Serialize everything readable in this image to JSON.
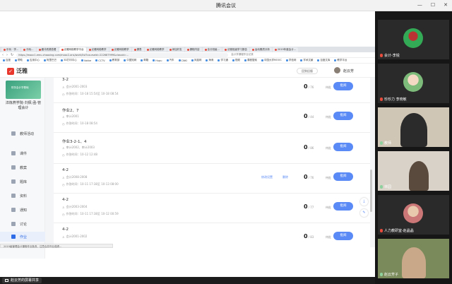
{
  "meeting": {
    "title": "腾讯会议"
  },
  "browser": {
    "tabs": [
      {
        "label": "乐玩 · 学..."
      },
      {
        "label": "乐玩..."
      },
      {
        "label": "缓冲资源查看"
      },
      {
        "label": "泛雅网络教学平台"
      },
      {
        "label": "泛雅网络教学"
      },
      {
        "label": "泛雅网络教学"
      },
      {
        "label": "课表"
      },
      {
        "label": "泛雅网络教学"
      },
      {
        "label": "添加好友"
      },
      {
        "label": "课程内容"
      },
      {
        "label": "全分班级..."
      },
      {
        "label": "泛雅班级学习报告"
      },
      {
        "label": "运动素质分析"
      },
      {
        "label": "2019年度会计..."
      }
    ],
    "url": "https://mooc1.emu.chaoxing.com/mooc2-ans/work/list?courseid=222687999&classid=...",
    "url_right": "会计学课程作业记录",
    "bookmarks": [
      "百度",
      "帮助",
      "应用中心",
      "阿里巴巴",
      "3D打印中心",
      "Vakke",
      "CCTV",
      "教育部",
      "中国知网",
      "邮箱",
      "Hupu",
      "汽车",
      "CNKI",
      "凤凰网",
      "海淘",
      "学习通",
      "视频",
      "课程搜索",
      "中国大学MOOC",
      "学信网",
      "学术文献",
      "百度文库",
      "教学平台"
    ]
  },
  "app": {
    "logo": "泛雅",
    "head_button": "回到旧版",
    "user": "赵云芳"
  },
  "sidebar": {
    "course_image_text": "财务会计学基础",
    "course_name": "淬炼燕学院-刘佩 函-管理会计",
    "items": [
      {
        "label": "教师活动"
      },
      {
        "label": "课件"
      },
      {
        "label": "教案"
      },
      {
        "label": "题库"
      },
      {
        "label": "资料"
      },
      {
        "label": "通知"
      },
      {
        "label": "讨论"
      },
      {
        "label": "作业"
      }
    ]
  },
  "homework": [
    {
      "title": "3-2",
      "cls": "会计2001-2003",
      "time": "作答时间：10-18 15:54至 10-18 08:54",
      "count": "0",
      "total": "/ 76",
      "count_label": "待批",
      "button": "批阅"
    },
    {
      "title": "作业2、7",
      "cls": "审计2001",
      "time": "作答时间：10-18 08:54",
      "count": "0",
      "total": "/ 44",
      "count_label": "待批",
      "button": "批阅"
    },
    {
      "title": "作业3-2-1、4",
      "cls": "审计2002、审计2003",
      "time": "作答时间：10-12 12:48",
      "count": "0",
      "total": "/ 86",
      "count_label": "待批",
      "button": "批阅"
    },
    {
      "title": "4-2",
      "cls": "会计2008-2008",
      "time": "作答时间：10-11 17:38至 10-13 08:00",
      "count": "0",
      "total": "/ 76",
      "count_label": "待批",
      "button": "批阅",
      "links": [
        "修改设置",
        "删除"
      ]
    },
    {
      "title": "4-2",
      "cls": "会计2003-2004",
      "time": "作答时间：10-11 17:38至 10-12 00:59",
      "count": "0",
      "total": "/ 77",
      "count_label": "待批",
      "button": "批阅"
    },
    {
      "title": "4-2",
      "cls": "会计2001-2002",
      "time": "",
      "count": "0",
      "total": "/ 83",
      "count_label": "待批",
      "button": "批阅"
    }
  ],
  "statusbar": "2019级管理会计课程作业批改，注意合并作业成绩...",
  "participants": [
    {
      "name": "会计-李锐",
      "mic_on": false
    },
    {
      "name": "珍珍力 李晓敏",
      "mic_on": false
    },
    {
      "name": "教师",
      "mic_on": true
    },
    {
      "name": "林园",
      "mic_on": true
    },
    {
      "name": "人力教研室-赵晶晶",
      "mic_on": false
    },
    {
      "name": "赵云芳子",
      "mic_on": true
    }
  ],
  "bottom": {
    "share_label": "赵云芳的屏幕共享"
  },
  "colors": {
    "accent": "#5a8af5",
    "brand": "#e8382d",
    "active_nav": "#2e6be6"
  }
}
